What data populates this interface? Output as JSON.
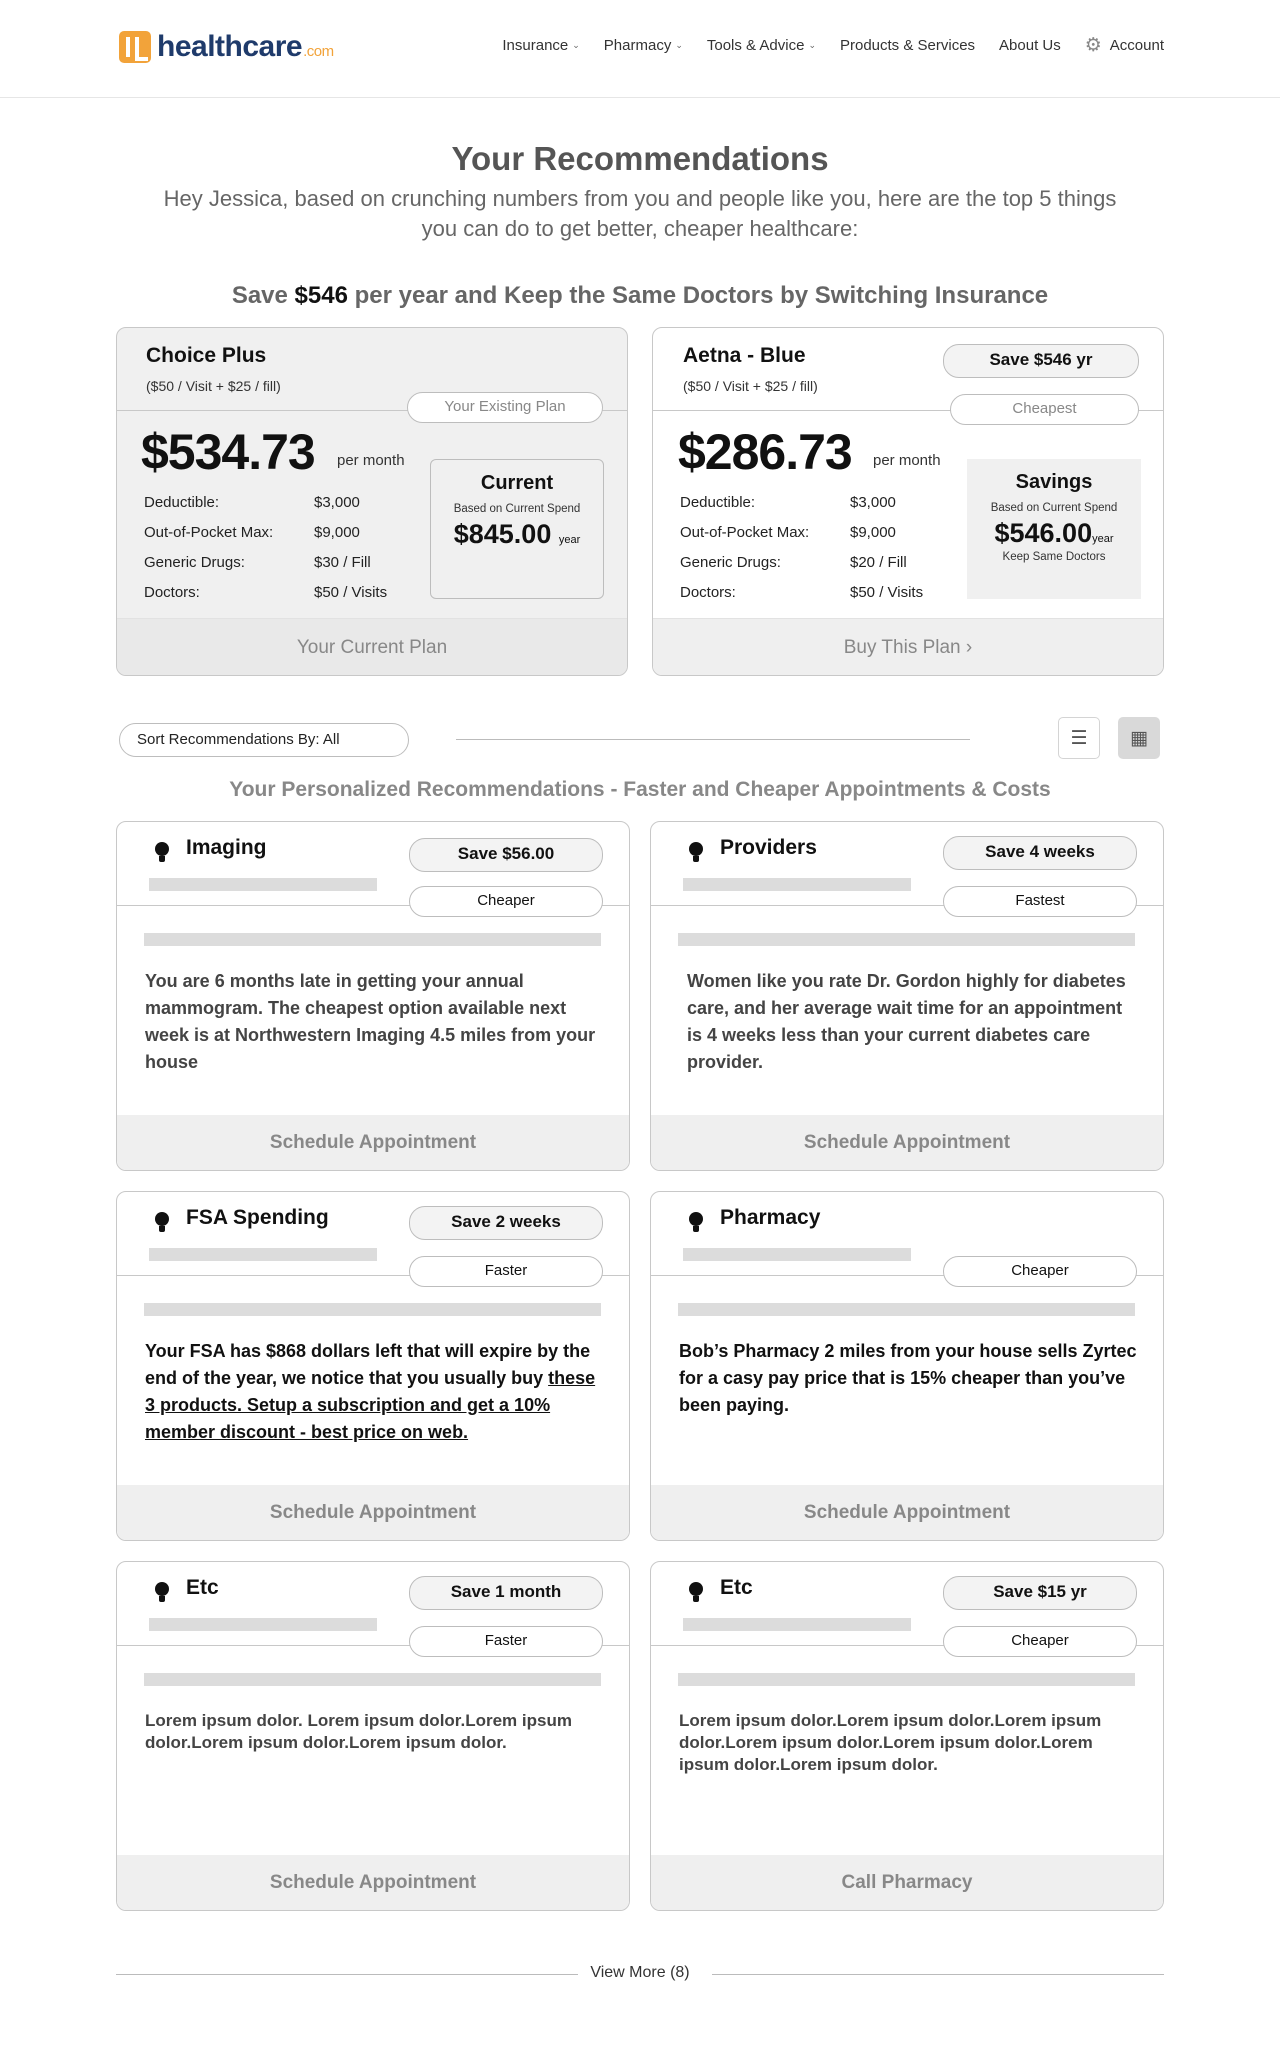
{
  "header": {
    "logo_text": "healthcare",
    "logo_suffix": ".com",
    "nav": [
      {
        "label": "Insurance"
      },
      {
        "label": "Pharmacy"
      },
      {
        "label": "Tools & Advice"
      },
      {
        "label": "Products & Services"
      },
      {
        "label": "About Us"
      },
      {
        "label": "Account"
      }
    ]
  },
  "page": {
    "title": "Your Recommendations",
    "subtitle_line1": "Hey Jessica, based on crunching numbers from you and people like you, here are the top 5 things",
    "subtitle_line2": "you can do to get better, cheaper healthcare:",
    "savings_prefix": "Save ",
    "savings_amount": "$546",
    "savings_suffix": " per year and Keep the Same Doctors by Switching Insurance"
  },
  "plans": [
    {
      "name": "Choice Plus",
      "subtitle": "($50 / Visit + $25 / fill)",
      "tag": "Your Existing Plan",
      "price": "$534.73",
      "price_unit": "per month",
      "specs": [
        {
          "label": "Deductible:",
          "value": "$3,000"
        },
        {
          "label": "Out-of-Pocket Max:",
          "value": "$9,000"
        },
        {
          "label": "Generic Drugs:",
          "value": "$30 / Fill"
        },
        {
          "label": "Doctors:",
          "value": "$50 / Visits"
        }
      ],
      "summary_title": "Current",
      "summary_note": "Based on Current Spend",
      "summary_amount": "$845.00",
      "summary_unit": "year",
      "footer": "Your Current Plan"
    },
    {
      "name": "Aetna - Blue",
      "subtitle": "($50 / Visit + $25 / fill)",
      "save_badge": "Save $546 yr",
      "tag": "Cheapest",
      "price": "$286.73",
      "price_unit": "per month",
      "specs": [
        {
          "label": "Deductible:",
          "value": "$3,000"
        },
        {
          "label": "Out-of-Pocket Max:",
          "value": "$9,000"
        },
        {
          "label": "Generic Drugs:",
          "value": "$20 / Fill"
        },
        {
          "label": "Doctors:",
          "value": "$50 / Visits"
        }
      ],
      "summary_title": "Savings",
      "summary_note": "Based on Current Spend",
      "summary_amount": "$546.00",
      "summary_unit": "year",
      "summary_foot": "Keep Same Doctors",
      "footer": "Buy This Plan ›"
    }
  ],
  "sort": {
    "label": "Sort Recommendations By: All"
  },
  "view_toggle": {
    "list_icon": "list-icon",
    "grid_icon": "grid-icon"
  },
  "recommendations_heading": "Your Personalized Recommendations - Faster and Cheaper Appointments & Costs",
  "cards": [
    {
      "title": "Imaging",
      "save": "Save $56.00",
      "tag": "Cheaper",
      "text": "You are 6 months late in getting your annual mammogram. The cheapest option available next week is at Northwestern Imaging 4.5 miles from your house",
      "action": "Schedule Appointment"
    },
    {
      "title": "Providers",
      "save": "Save 4 weeks",
      "tag": "Fastest",
      "text": "Women like you rate Dr. Gordon highly for diabetes care, and her average wait time for an appointment is 4 weeks less than your current diabetes care provider.",
      "action": "Schedule Appointment"
    },
    {
      "title": "FSA Spending",
      "save": "Save 2 weeks",
      "tag": "Faster",
      "text_plain": "Your FSA has $868 dollars left that will expire by the end of the year, we notice that you usually buy ",
      "text_link": "these 3 products. Setup a subscription and get a 10% member discount - best price on web.",
      "action": "Schedule Appointment"
    },
    {
      "title": "Pharmacy",
      "tag": "Cheaper",
      "text": "Bob’s Pharmacy 2 miles from your house sells Zyrtec for a casy pay price that is 15% cheaper than you’ve been paying.",
      "action": "Schedule Appointment"
    },
    {
      "title": "Etc",
      "save": "Save 1 month",
      "tag": "Faster",
      "text": "Lorem ipsum dolor. Lorem ipsum dolor.Lorem ipsum dolor.Lorem ipsum dolor.Lorem ipsum dolor.",
      "action": "Schedule Appointment"
    },
    {
      "title": "Etc",
      "save": "Save $15 yr",
      "tag": "Cheaper",
      "text": "Lorem ipsum dolor.Lorem ipsum dolor.Lorem ipsum dolor.Lorem ipsum dolor.Lorem ipsum dolor.Lorem ipsum dolor.Lorem ipsum dolor.",
      "action": "Call Pharmacy"
    }
  ],
  "view_more": "View More (8)"
}
